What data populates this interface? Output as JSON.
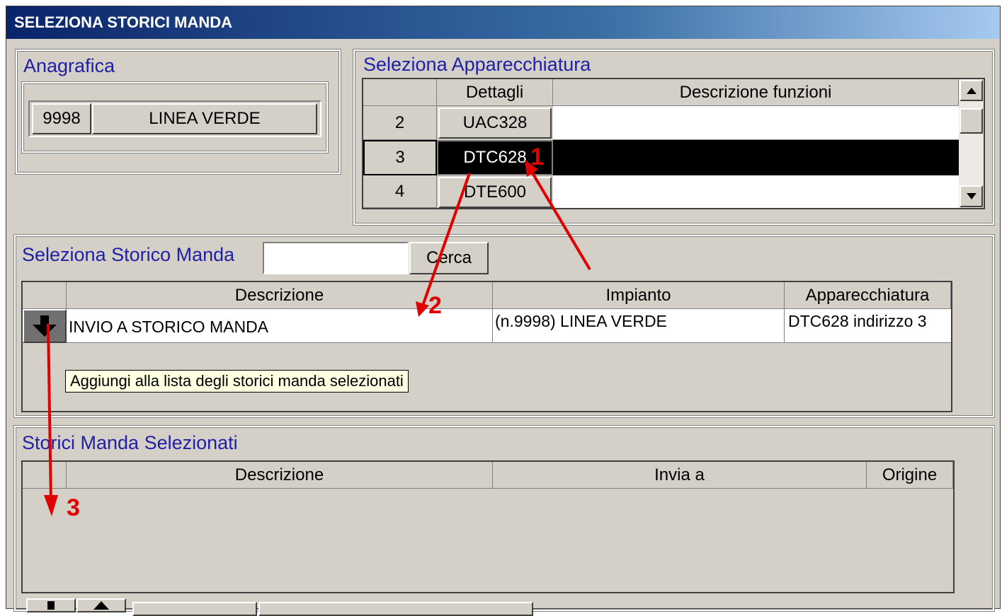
{
  "window": {
    "title": "SELEZIONA STORICI MANDA"
  },
  "anagrafica": {
    "title": "Anagrafica",
    "code": "9998",
    "name": "LINEA VERDE"
  },
  "apparecchiatura": {
    "title": "Seleziona Apparecchiatura",
    "columns": [
      "Dettagli",
      "Descrizione funzioni"
    ],
    "rows": [
      {
        "num": "2",
        "detail": "UAC328",
        "desc": ""
      },
      {
        "num": "3",
        "detail": "DTC628",
        "desc": ""
      },
      {
        "num": "4",
        "detail": "DTE600",
        "desc": ""
      }
    ]
  },
  "storico": {
    "title": "Seleziona Storico Manda",
    "search_value": "",
    "search_button": "Cerca",
    "columns": [
      "Descrizione",
      "Impianto",
      "Apparecchiatura"
    ],
    "rows": [
      {
        "descrizione": "INVIO A STORICO MANDA",
        "impianto": "(n.9998) LINEA VERDE",
        "apparecchiatura": "DTC628 indirizzo 3"
      }
    ],
    "tooltip": "Aggiungi alla lista degli storici manda selezionati"
  },
  "selezionati": {
    "title": "Storici Manda Selezionati",
    "columns": [
      "Descrizione",
      "Invia a",
      "Origine"
    ]
  },
  "annotations": {
    "step1": "1",
    "step2": "2",
    "step3": "3"
  },
  "colors": {
    "title_bar": "#0a246a",
    "section_title": "#1f1fa8",
    "annotation": "#e00000",
    "selected_row": "#000000"
  },
  "icons": [
    "scroll-up-arrow-icon",
    "scroll-down-arrow-icon",
    "add-down-arrow-icon",
    "move-up-arrow-icon"
  ]
}
